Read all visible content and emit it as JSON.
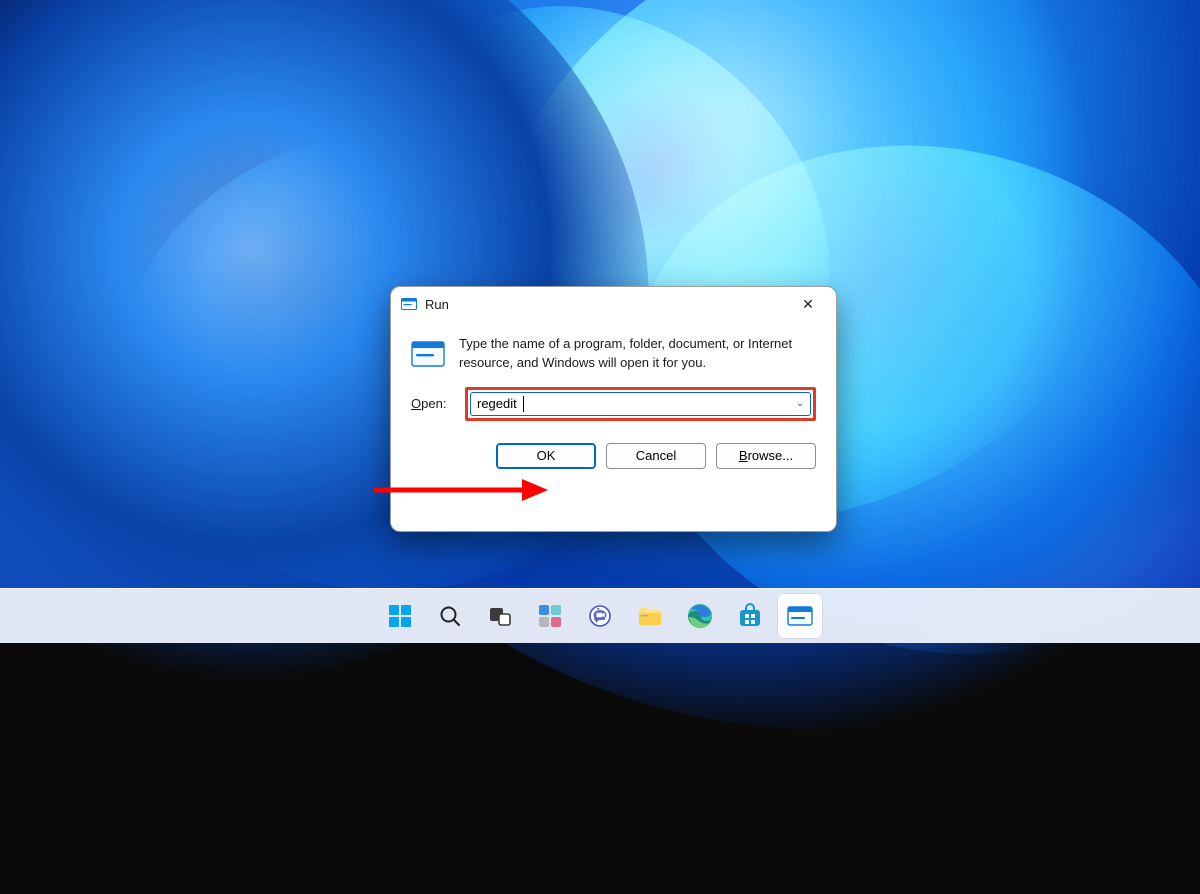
{
  "dialog": {
    "title": "Run",
    "description": "Type the name of a program, folder, document, or Internet resource, and Windows will open it for you.",
    "open_label_underlined": "O",
    "open_label_rest": "pen:",
    "input_value": "regedit",
    "buttons": {
      "ok": "OK",
      "cancel": "Cancel",
      "browse_underlined": "B",
      "browse_rest": "rowse..."
    }
  },
  "annotation": {
    "highlight_color": "#e03a2a",
    "arrow_color": "#ff0000"
  },
  "taskbar": {
    "items": [
      {
        "name": "start",
        "icon": "windows-logo"
      },
      {
        "name": "search",
        "icon": "magnifier"
      },
      {
        "name": "task-view",
        "icon": "task-view"
      },
      {
        "name": "widgets",
        "icon": "widgets"
      },
      {
        "name": "chat",
        "icon": "chat"
      },
      {
        "name": "file-explorer",
        "icon": "folder"
      },
      {
        "name": "edge",
        "icon": "edge"
      },
      {
        "name": "store",
        "icon": "store"
      },
      {
        "name": "run",
        "icon": "run-app",
        "active": true
      }
    ]
  }
}
